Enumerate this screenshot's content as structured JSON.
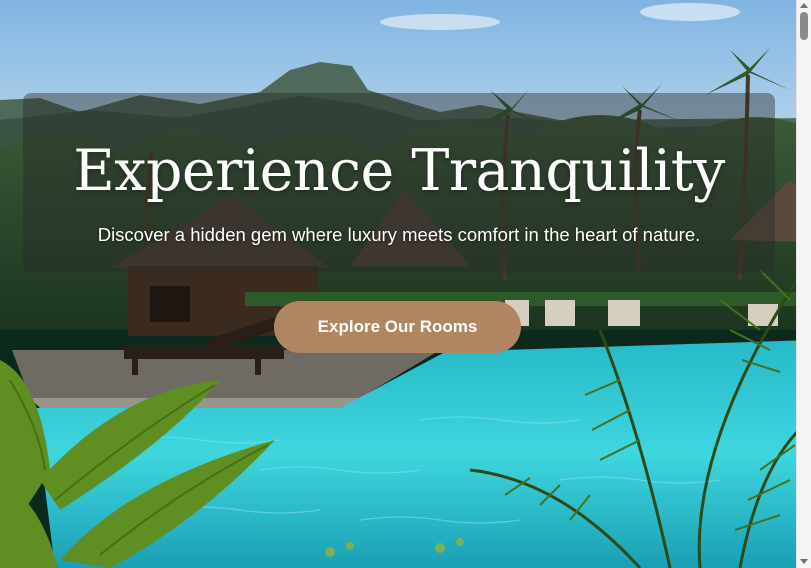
{
  "hero": {
    "title": "Experience Tranquility",
    "subtitle": "Discover a hidden gem where luxury meets comfort in the heart of nature.",
    "cta_label": "Explore Our Rooms",
    "background_icon": "tropical-resort-pool-photo"
  },
  "colors": {
    "accent": "#b08562",
    "overlay": "rgba(40,40,40,0.42)",
    "pool": "#2ec9d6",
    "text": "#ffffff"
  },
  "scrollbar": {
    "position": 0.0
  }
}
